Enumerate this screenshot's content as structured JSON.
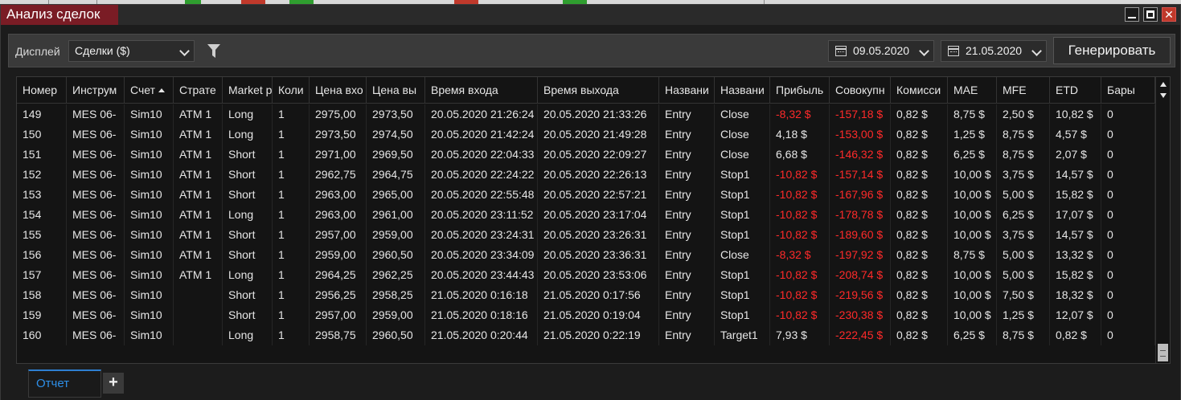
{
  "window": {
    "title": "Анализ сделок",
    "minimize_icon": "minimize-icon",
    "maximize_icon": "maximize-icon",
    "close_label": "✕"
  },
  "toolbar": {
    "display_label": "Дисплей",
    "display_value": "Сделки ($)",
    "filter_icon": "filter-icon",
    "date_from": "09.05.2020",
    "date_to": "21.05.2020",
    "calendar_icon": "calendar-icon",
    "generate_label": "Генерировать"
  },
  "grid": {
    "columns": [
      "Номер",
      "Инструм",
      "Счет",
      "Страте",
      "Market p",
      "Коли",
      "Цена вхо",
      "Цена вы",
      "Время входа",
      "Время выхода",
      "Названи",
      "Названи",
      "Прибыль",
      "Совокупн",
      "Комисси",
      "MAE",
      "MFE",
      "ETD",
      "Бары"
    ],
    "sorted_column": 2,
    "rows": [
      [
        "149",
        "MES 06-",
        "Sim10",
        "ATM 1",
        "Long",
        "1",
        "2975,00",
        "2973,50",
        "20.05.2020 21:26:24",
        "20.05.2020 21:33:26",
        "Entry",
        "Close",
        "-8,32 $",
        "-157,18 $",
        "0,82 $",
        "8,75 $",
        "2,50 $",
        "10,82 $",
        "0"
      ],
      [
        "150",
        "MES 06-",
        "Sim10",
        "ATM 1",
        "Long",
        "1",
        "2973,50",
        "2974,50",
        "20.05.2020 21:42:24",
        "20.05.2020 21:49:28",
        "Entry",
        "Close",
        "4,18 $",
        "-153,00 $",
        "0,82 $",
        "1,25 $",
        "8,75 $",
        "4,57 $",
        "0"
      ],
      [
        "151",
        "MES 06-",
        "Sim10",
        "ATM 1",
        "Short",
        "1",
        "2971,00",
        "2969,50",
        "20.05.2020 22:04:33",
        "20.05.2020 22:09:27",
        "Entry",
        "Close",
        "6,68 $",
        "-146,32 $",
        "0,82 $",
        "6,25 $",
        "8,75 $",
        "2,07 $",
        "0"
      ],
      [
        "152",
        "MES 06-",
        "Sim10",
        "ATM 1",
        "Short",
        "1",
        "2962,75",
        "2964,75",
        "20.05.2020 22:24:22",
        "20.05.2020 22:26:13",
        "Entry",
        "Stop1",
        "-10,82 $",
        "-157,14 $",
        "0,82 $",
        "10,00 $",
        "3,75 $",
        "14,57 $",
        "0"
      ],
      [
        "153",
        "MES 06-",
        "Sim10",
        "ATM 1",
        "Short",
        "1",
        "2963,00",
        "2965,00",
        "20.05.2020 22:55:48",
        "20.05.2020 22:57:21",
        "Entry",
        "Stop1",
        "-10,82 $",
        "-167,96 $",
        "0,82 $",
        "10,00 $",
        "5,00 $",
        "15,82 $",
        "0"
      ],
      [
        "154",
        "MES 06-",
        "Sim10",
        "ATM 1",
        "Long",
        "1",
        "2963,00",
        "2961,00",
        "20.05.2020 23:11:52",
        "20.05.2020 23:17:04",
        "Entry",
        "Stop1",
        "-10,82 $",
        "-178,78 $",
        "0,82 $",
        "10,00 $",
        "6,25 $",
        "17,07 $",
        "0"
      ],
      [
        "155",
        "MES 06-",
        "Sim10",
        "ATM 1",
        "Short",
        "1",
        "2957,00",
        "2959,00",
        "20.05.2020 23:24:31",
        "20.05.2020 23:26:31",
        "Entry",
        "Stop1",
        "-10,82 $",
        "-189,60 $",
        "0,82 $",
        "10,00 $",
        "3,75 $",
        "14,57 $",
        "0"
      ],
      [
        "156",
        "MES 06-",
        "Sim10",
        "ATM 1",
        "Short",
        "1",
        "2959,00",
        "2960,50",
        "20.05.2020 23:34:09",
        "20.05.2020 23:36:31",
        "Entry",
        "Close",
        "-8,32 $",
        "-197,92 $",
        "0,82 $",
        "8,75 $",
        "5,00 $",
        "13,32 $",
        "0"
      ],
      [
        "157",
        "MES 06-",
        "Sim10",
        "ATM 1",
        "Long",
        "1",
        "2964,25",
        "2962,25",
        "20.05.2020 23:44:43",
        "20.05.2020 23:53:06",
        "Entry",
        "Stop1",
        "-10,82 $",
        "-208,74 $",
        "0,82 $",
        "10,00 $",
        "5,00 $",
        "15,82 $",
        "0"
      ],
      [
        "158",
        "MES 06-",
        "Sim10",
        "",
        "Short",
        "1",
        "2956,25",
        "2958,25",
        "21.05.2020 0:16:18",
        "21.05.2020 0:17:56",
        "Entry",
        "Stop1",
        "-10,82 $",
        "-219,56 $",
        "0,82 $",
        "10,00 $",
        "7,50 $",
        "18,32 $",
        "0"
      ],
      [
        "159",
        "MES 06-",
        "Sim10",
        "",
        "Short",
        "1",
        "2957,00",
        "2959,00",
        "21.05.2020 0:18:16",
        "21.05.2020 0:19:04",
        "Entry",
        "Stop1",
        "-10,82 $",
        "-230,38 $",
        "0,82 $",
        "10,00 $",
        "1,25 $",
        "12,07 $",
        "0"
      ],
      [
        "160",
        "MES 06-",
        "Sim10",
        "",
        "Long",
        "1",
        "2958,75",
        "2960,50",
        "21.05.2020 0:20:44",
        "21.05.2020 0:22:19",
        "Entry",
        "Target1",
        "7,93 $",
        "-222,45 $",
        "0,82 $",
        "6,25 $",
        "8,75 $",
        "0,82 $",
        "0"
      ]
    ]
  },
  "tabs": {
    "report_label": "Отчет",
    "add_label": "+"
  },
  "colors": {
    "title_tab": "#7a1c25",
    "negative": "#ff2a2a",
    "active_tab": "#2e8fe8",
    "close_button": "#c0392b"
  }
}
